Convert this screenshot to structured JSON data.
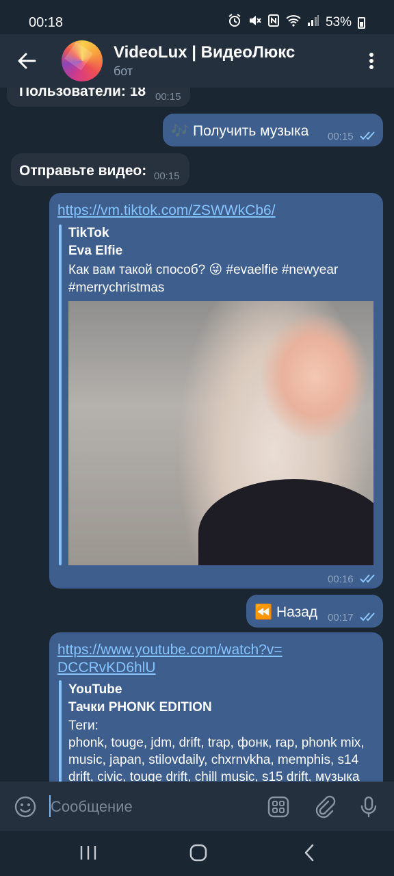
{
  "status": {
    "time": "00:18",
    "battery": "53%",
    "icons": [
      "alarm-icon",
      "mute-icon",
      "nfc-icon",
      "wifi-icon",
      "signal-icon",
      "battery-icon"
    ]
  },
  "header": {
    "title": "VideoLux | ВидеоЛюкс",
    "subtitle": "бот",
    "icons": [
      "back-arrow-icon",
      "more-vert-icon"
    ]
  },
  "messages": [
    {
      "direction": "in",
      "text": "Пользователи: 18",
      "time": "00:15"
    },
    {
      "direction": "out",
      "text": "🎶 Получить музыка",
      "time": "00:15"
    },
    {
      "direction": "in",
      "text": "Отправьте видео:",
      "time": "00:15"
    },
    {
      "direction": "out",
      "link": "https://vm.tiktok.com/ZSWWkCb6/",
      "preview": {
        "site": "TikTok",
        "title": "Eva Elfie",
        "desc_line1": "Как вам такой способ? 😜 #evaelfie #newyear",
        "desc_line2": "#merrychristmas"
      },
      "time": "00:16"
    },
    {
      "direction": "out",
      "text": "⏪ Назад",
      "time": "00:17"
    },
    {
      "direction": "out",
      "link_line1": "https://www.youtube.com/watch?v=",
      "link_line2": "DCCRvKD6hlU",
      "preview": {
        "site": "YouTube",
        "title": "Тачки PHONK EDITION",
        "desc_line1": "Теги:",
        "desc_line2": "phonk, touge, jdm, drift, trap, фонк, rap, phonk mix,",
        "desc_line3": "music, japan, stilovdaily, chxrnvkha, memphis, s14",
        "desc_line4": "drift, civic, touge drift, chill music, s15 drift, музыка"
      }
    }
  ],
  "input": {
    "placeholder": "Сообщение",
    "icons": [
      "emoji-icon",
      "bot-keyboard-icon",
      "attach-icon",
      "mic-icon"
    ]
  },
  "navbar": {
    "icons": [
      "recents-icon",
      "home-icon",
      "back-icon"
    ]
  },
  "colors": {
    "background": "#1b2633",
    "header": "#25303e",
    "incoming_bubble": "#28323f",
    "outgoing_bubble": "#3e5f8d",
    "link": "#86c4ff"
  }
}
